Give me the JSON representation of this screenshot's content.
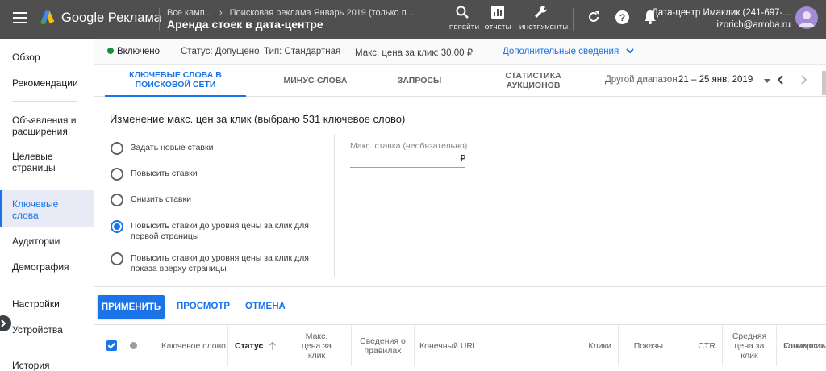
{
  "topbar": {
    "product_name": "Google Реклама",
    "breadcrumb_all_campaigns": "Все камп...",
    "breadcrumb_campaign": "Поисковая реклама Январь 2019 (только п...",
    "ad_group_title": "Аренда стоек в дата-центре",
    "go_to_label": "ПЕРЕЙТИ",
    "reports_label": "ОТЧЕТЫ",
    "tools_label": "ИНСТРУМЕНТЫ",
    "account_name": "Дата-центр Имаклик (241-697-...",
    "account_email": "izorich@arroba.ru"
  },
  "sidebar": {
    "items": [
      {
        "label": "Обзор"
      },
      {
        "label": "Рекомендации"
      },
      {
        "label": "Объявления и расширения"
      },
      {
        "label": "Целевые страницы"
      },
      {
        "label": "Ключевые слова"
      },
      {
        "label": "Аудитории"
      },
      {
        "label": "Демография"
      },
      {
        "label": "Настройки"
      },
      {
        "label": "Устройства"
      },
      {
        "label": "История"
      }
    ]
  },
  "statusbar": {
    "enabled": "Включено",
    "status": "Статус: Допущено",
    "type": "Тип: Стандартная",
    "max_cpc": "Макс. цена за клик: 30,00 ₽",
    "more_details": "Дополнительные сведения"
  },
  "tabs": {
    "items": [
      {
        "label": "Ключевые слова в поисковой сети"
      },
      {
        "label": "Минус-слова"
      },
      {
        "label": "Запросы"
      },
      {
        "label": "Статистика аукционов"
      }
    ],
    "other_range_label": "Другой диапазон",
    "date_range": "21 – 25 янв. 2019"
  },
  "edit_panel": {
    "title": "Изменение макс. цен за клик (выбрано 531 ключевое слово)",
    "options": [
      {
        "label": "Задать новые ставки",
        "selected": false
      },
      {
        "label": "Повысить ставки",
        "selected": false
      },
      {
        "label": "Снизить ставки",
        "selected": false
      },
      {
        "label": "Повысить ставки до уровня цены за клик для первой страницы",
        "selected": true
      },
      {
        "label": "Повысить ставки до уровня цены за клик для показа вверху страницы",
        "selected": false
      }
    ],
    "max_bid_label": "Макс. ставка (необязательно)",
    "currency": "₽"
  },
  "actions": {
    "apply": "ПРИМЕНИТЬ",
    "preview": "ПРОСМОТР",
    "cancel": "ОТМЕНА"
  },
  "table": {
    "columns": [
      {
        "label": "Ключевое слово"
      },
      {
        "label": "Статус"
      },
      {
        "label": "Макс. цена за клик"
      },
      {
        "label": "Сведения о правилах"
      },
      {
        "label": "Конечный URL"
      },
      {
        "label": "Клики"
      },
      {
        "label": "Показы"
      },
      {
        "label": "CTR"
      },
      {
        "label": "Средняя цена за клик"
      },
      {
        "label": "Стоимость"
      },
      {
        "label": "Конверсии"
      }
    ]
  },
  "colors": {
    "accent": "#1a73e8",
    "topbar": "#4f4f4f",
    "enabled_dot": "#1e8e3e"
  }
}
